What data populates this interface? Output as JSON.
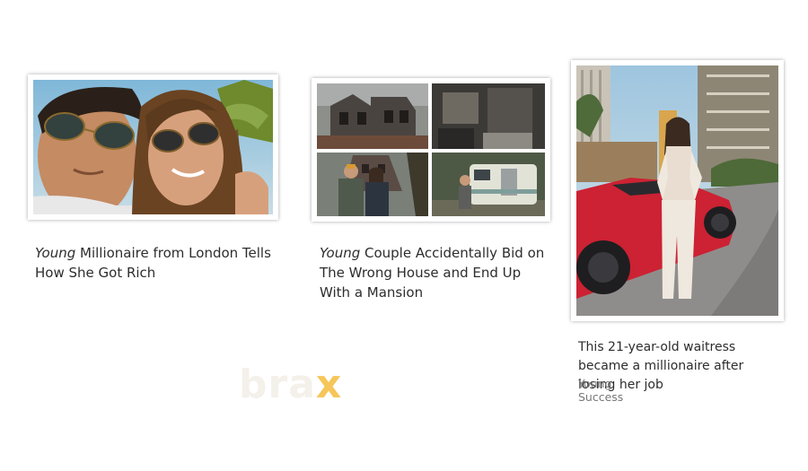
{
  "cards": [
    {
      "headline_italic": "Young",
      "headline_rest": " Millionaire from London Tells How She Got Rich"
    },
    {
      "headline_italic": "Young",
      "headline_rest": " Couple Accidentally Bid on The Wrong House and End Up With a Mansion"
    },
    {
      "headline": "This 21-year-old waitress became a millionaire after losing her job",
      "source": "Young Success"
    }
  ],
  "logo": {
    "text": "bra",
    "accent": "x"
  },
  "colors": {
    "accent": "#f6c65a",
    "headline": "#2d2d2d",
    "source": "#777777"
  }
}
